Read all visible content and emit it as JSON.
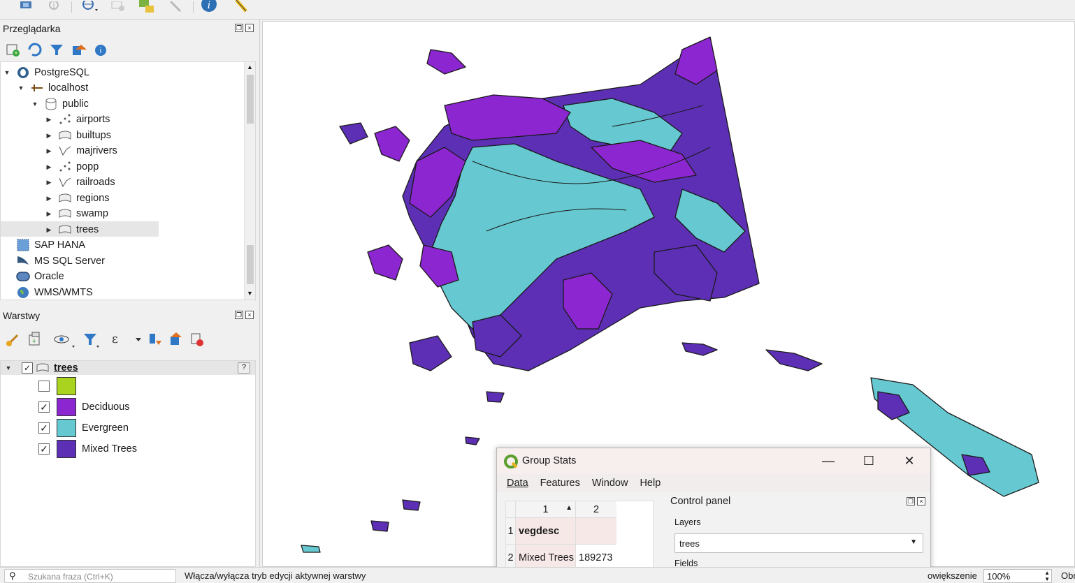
{
  "browser_panel": {
    "title": "Przeglądarka",
    "tree": {
      "postgres": "PostgreSQL",
      "host": "localhost",
      "schema": "public",
      "tables": [
        "airports",
        "builtups",
        "majrivers",
        "popp",
        "railroads",
        "regions",
        "swamp",
        "trees"
      ],
      "others": [
        "SAP HANA",
        "MS SQL Server",
        "Oracle",
        "WMS/WMTS"
      ]
    }
  },
  "layers_panel": {
    "title": "Warstwy",
    "layer_name": "trees",
    "help_icon": "?",
    "legend": [
      {
        "label": "",
        "color": "#a9d31f",
        "checked": false
      },
      {
        "label": "Deciduous",
        "color": "#8c26d0",
        "checked": true
      },
      {
        "label": "Evergreen",
        "color": "#66c8d0",
        "checked": true
      },
      {
        "label": "Mixed Trees",
        "color": "#5c2fb5",
        "checked": true
      }
    ]
  },
  "map_colors": {
    "deciduous": "#8c26d0",
    "evergreen": "#66c8d0",
    "mixed": "#5c2fb5",
    "outline": "#1a1a1a"
  },
  "group_stats": {
    "title": "Group Stats",
    "menu": [
      "Data",
      "Features",
      "Window",
      "Help"
    ],
    "table": {
      "col_headers": [
        "1",
        "2"
      ],
      "row_headers": [
        "1",
        "2"
      ],
      "rows": [
        [
          "vegdesc",
          ""
        ],
        [
          "Mixed Trees",
          "189273"
        ]
      ]
    },
    "control_panel": {
      "title": "Control panel",
      "layers_label": "Layers",
      "layer_value": "trees",
      "fields_label": "Fields"
    }
  },
  "statusbar": {
    "search_placeholder": "Szukana fraza (Ctrl+K)",
    "message": "Włącza/wyłącza tryb edycji aktywnej warstwy",
    "zoom_label": "owiększenie",
    "zoom_value": "100%",
    "right_label": "Obr"
  }
}
